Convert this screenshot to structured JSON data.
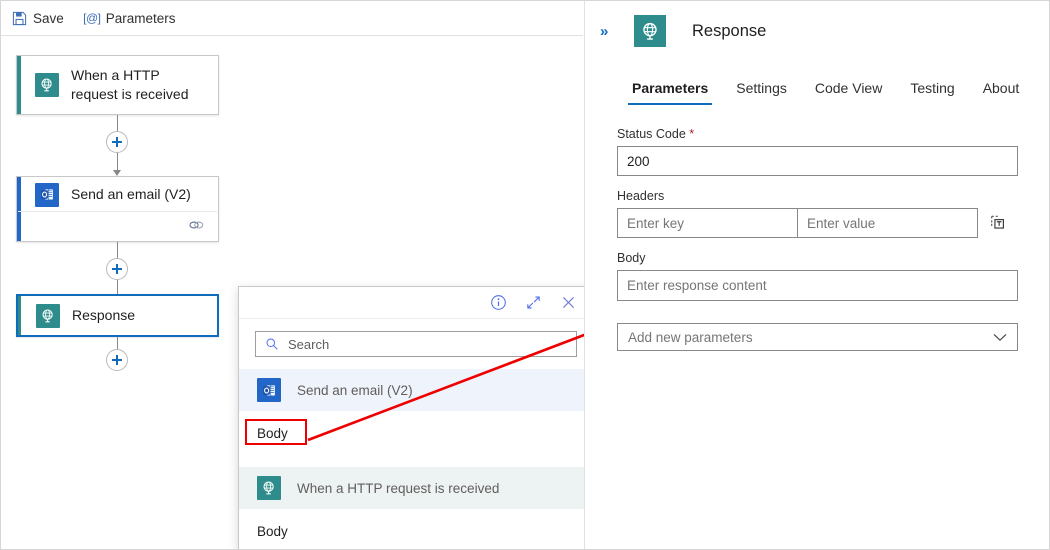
{
  "toolbar": {
    "save_label": "Save",
    "save_icon": "save-floppy-icon",
    "parameters_label": "Parameters",
    "parameters_icon": "at-bracket-icon"
  },
  "designer": {
    "cards": [
      {
        "title": "When a HTTP request is received",
        "icon": "http-globe-icon",
        "accent": "#2f8c8c",
        "selected": false
      },
      {
        "title": "Send an email (V2)",
        "icon": "outlook-icon",
        "accent": "#2266c8",
        "selected": false,
        "footer_icon": "chain-link-icon"
      },
      {
        "title": "Response",
        "icon": "http-globe-icon",
        "accent": "#2f8c8c",
        "selected": true
      }
    ],
    "add_button_label": "+"
  },
  "dynamic_content": {
    "header_icons": [
      "info-circle-icon",
      "expand-diagonal-icon",
      "close-icon"
    ],
    "search": {
      "placeholder": "Search",
      "value": "",
      "icon": "search-icon"
    },
    "groups": [
      {
        "label": "Send an email (V2)",
        "icon": "outlook-icon",
        "items": [
          "Body"
        ]
      },
      {
        "label": "When a HTTP request is received",
        "icon": "http-globe-icon",
        "items": [
          "Body"
        ]
      }
    ]
  },
  "pane": {
    "collapse_icon": "double-chevron-right-icon",
    "icon": "http-globe-icon",
    "title": "Response",
    "tabs": [
      {
        "label": "Parameters",
        "active": true
      },
      {
        "label": "Settings",
        "active": false
      },
      {
        "label": "Code View",
        "active": false
      },
      {
        "label": "Testing",
        "active": false
      },
      {
        "label": "About",
        "active": false
      }
    ],
    "fields": {
      "status_code_label": "Status Code",
      "status_code_required": "*",
      "status_code_value": "200",
      "headers_label": "Headers",
      "header_key_placeholder": "Enter key",
      "header_value_placeholder": "Enter value",
      "headers_tool_icon": "switch-to-text-mode-icon",
      "body_label": "Body",
      "body_placeholder": "Enter response content",
      "add_parameters_label": "Add new parameters",
      "add_parameters_chevron": "chevron-down-icon"
    }
  },
  "annotations": {
    "highlight_color": "#ef0000",
    "arrow_from": "Body (dynamic content item)",
    "arrow_to": "Body field input"
  }
}
